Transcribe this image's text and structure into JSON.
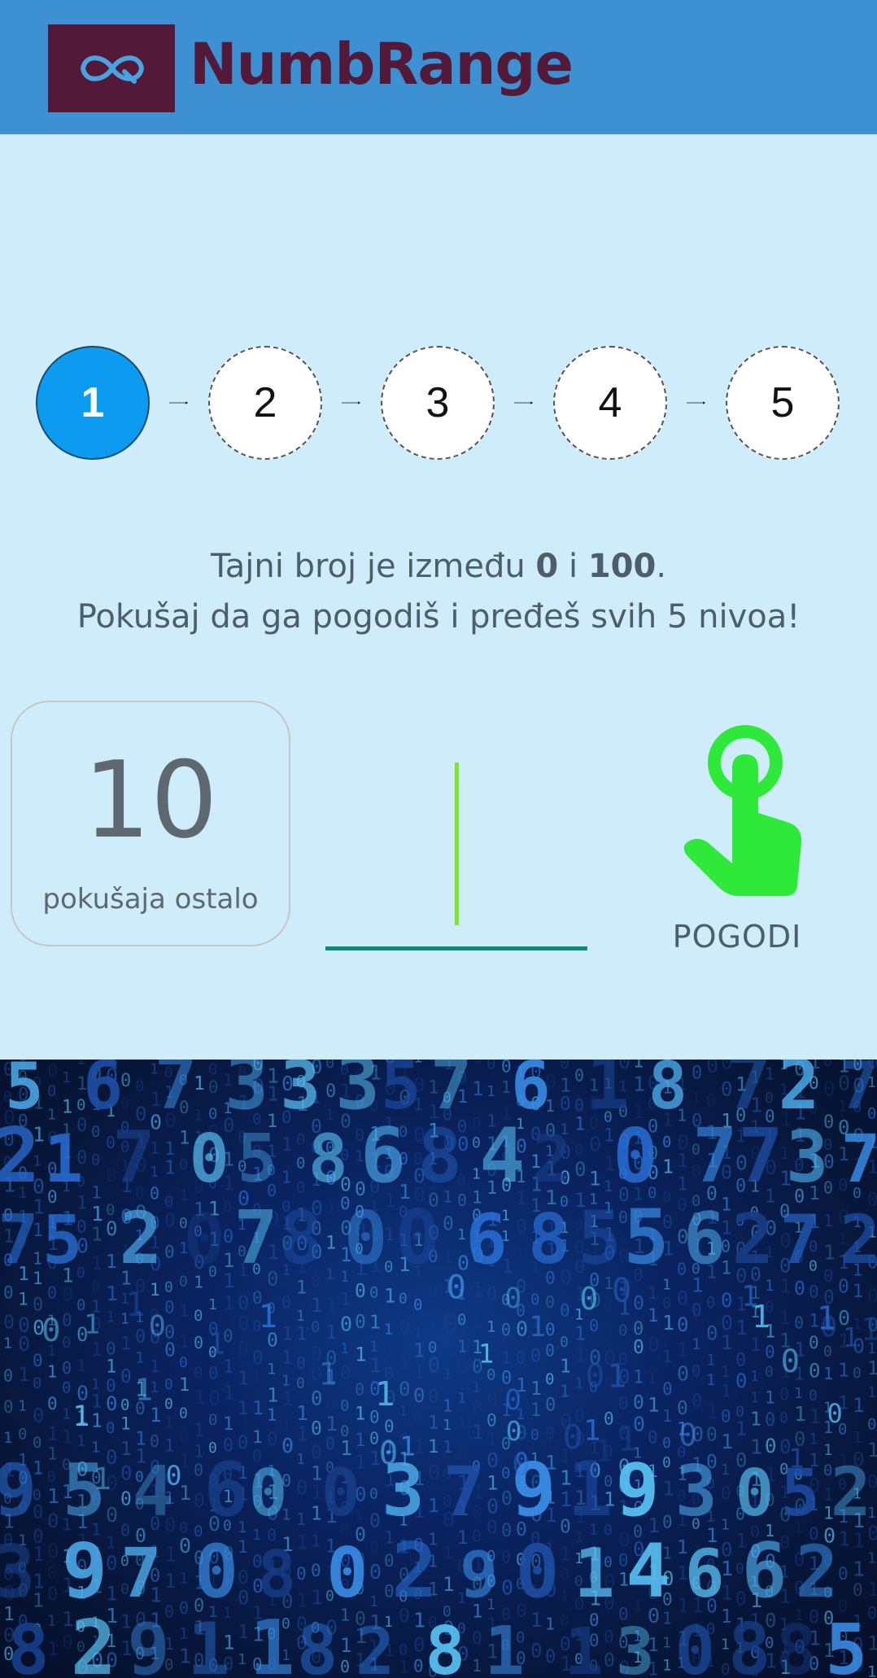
{
  "app": {
    "title": "NumbRange",
    "logo_icon": "infinity-icon"
  },
  "levels": [
    {
      "label": "1",
      "state": "active"
    },
    {
      "label": "2",
      "state": "locked"
    },
    {
      "label": "3",
      "state": "locked"
    },
    {
      "label": "4",
      "state": "locked"
    },
    {
      "label": "5",
      "state": "locked"
    }
  ],
  "instructions": {
    "line1_prefix": "Tajni broj je između ",
    "range_min": "0",
    "line1_and": " i ",
    "range_max": "100",
    "line1_suffix": ".",
    "line2": "Pokušaj da ga pogodiš i pređeš svih 5 nivoa!"
  },
  "attempts": {
    "count": "10",
    "label": "pokušaja ostalo"
  },
  "guess_input": {
    "value": "",
    "placeholder": ""
  },
  "guess_button": {
    "label": "POGODI",
    "icon": "tap-hand-icon"
  },
  "colors": {
    "header_bg": "#3d91d3",
    "logo_bg": "#521a38",
    "page_bg": "#cfecfa",
    "active_level": "#0d9bf2",
    "accent_green": "#2ee83a",
    "input_underline": "#0d8a7a"
  },
  "background": {
    "type": "digital-number-rain"
  }
}
